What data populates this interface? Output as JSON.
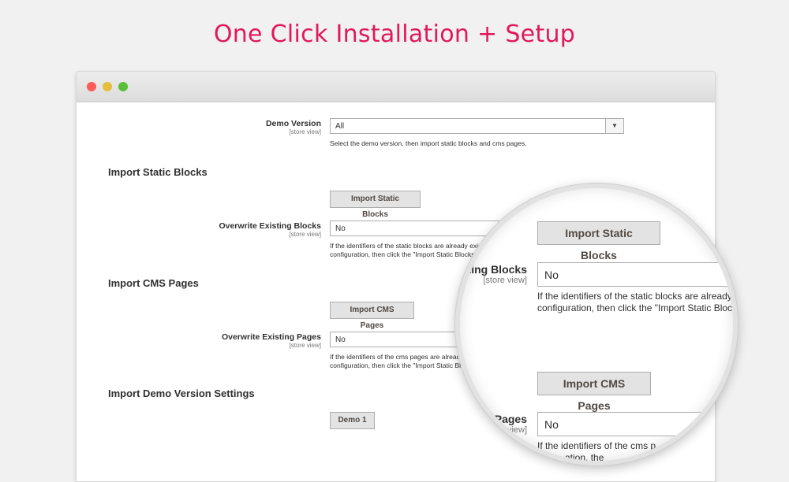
{
  "headline": "One Click Installation + Setup",
  "window_controls": [
    "close",
    "minimize",
    "maximize"
  ],
  "demo_version": {
    "label": "Demo Version",
    "scope": "[store view]",
    "value": "All",
    "note": "Select the demo version, then import static blocks and cms pages."
  },
  "static_blocks": {
    "section_title": "Import Static Blocks",
    "button": "Import Static Blocks",
    "overwrite_label": "Overwrite Existing Blocks",
    "overwrite_scope": "[store view]",
    "overwrite_value": "No",
    "note_line1": "If the identifiers of the static blocks are already exis",
    "note_line2": "configuration, then click the \"Import Static Blocks\""
  },
  "cms_pages": {
    "section_title": "Import CMS Pages",
    "button": "Import CMS Pages",
    "overwrite_label": "Overwrite Existing Pages",
    "overwrite_scope": "[store view]",
    "overwrite_value": "No",
    "note_line1": "If the identifiers of the cms pages are already",
    "note_line2": "configuration, then click the \"Import Static Blo"
  },
  "demo_settings": {
    "section_title": "Import Demo Version Settings",
    "button": "Demo 1"
  },
  "magnifier": {
    "static_button": "Import Static Blocks",
    "blocks_label": "ting Blocks",
    "blocks_scope": "[store view]",
    "blocks_value": "No",
    "blocks_note_line1": "If the identifiers of the static blocks are already",
    "blocks_note_line2": "configuration, then click the \"Import Static Block",
    "cms_button": "Import CMS Pages",
    "pages_label": "Pages",
    "pages_scope": "view]",
    "pages_value": "No",
    "pages_note_line1": "If the identifiers of the cms p",
    "pages_note_line2": "ation, the"
  }
}
